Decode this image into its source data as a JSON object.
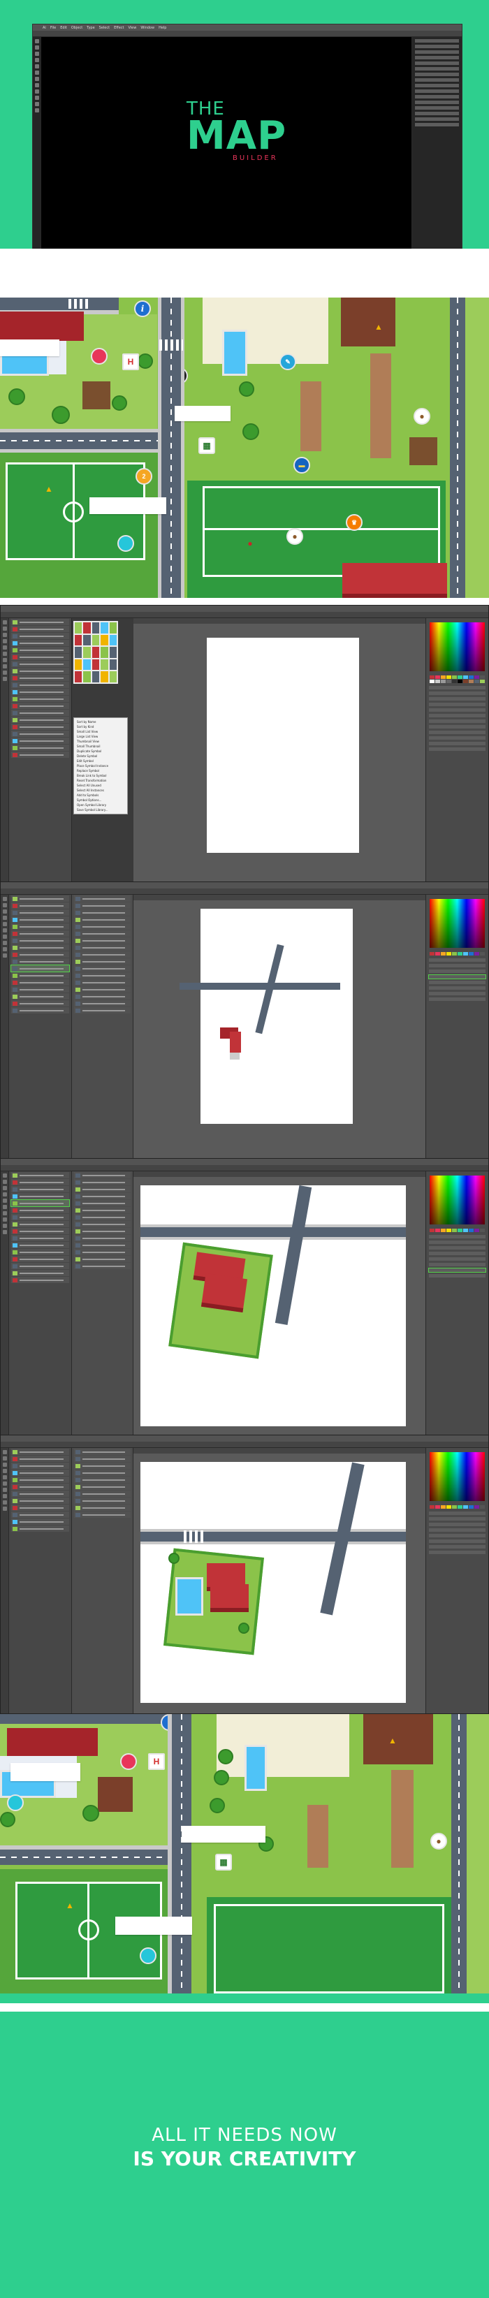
{
  "hero": {
    "the": "THE",
    "map": "MAP",
    "builder": "BUILDER",
    "colors": {
      "green": "#2ecf8e",
      "red": "#e8355a",
      "window": "#000000"
    }
  },
  "app": {
    "menu": [
      "Ai",
      "File",
      "Edit",
      "Object",
      "Type",
      "Select",
      "Effect",
      "View",
      "Window",
      "Help"
    ]
  },
  "context_menu": [
    "Sort by Name",
    "Sort by Kind",
    "Small List View",
    "Large List View",
    "Thumbnail View",
    "Small Thumbnail",
    "Duplicate Symbol",
    "Delete Symbol",
    "Edit Symbol",
    "Place Symbol Instance",
    "Replace Symbol",
    "Break Link to Symbol",
    "Reset Transformation",
    "Select All Unused",
    "Select All Instances",
    "Add to Symbols",
    "Symbol Options...",
    "Open Symbol Library",
    "Save Symbol Library..."
  ],
  "banner": {
    "line1": "ALL IT NEEDS NOW",
    "line2": "IS YOUR CREATIVITY"
  }
}
